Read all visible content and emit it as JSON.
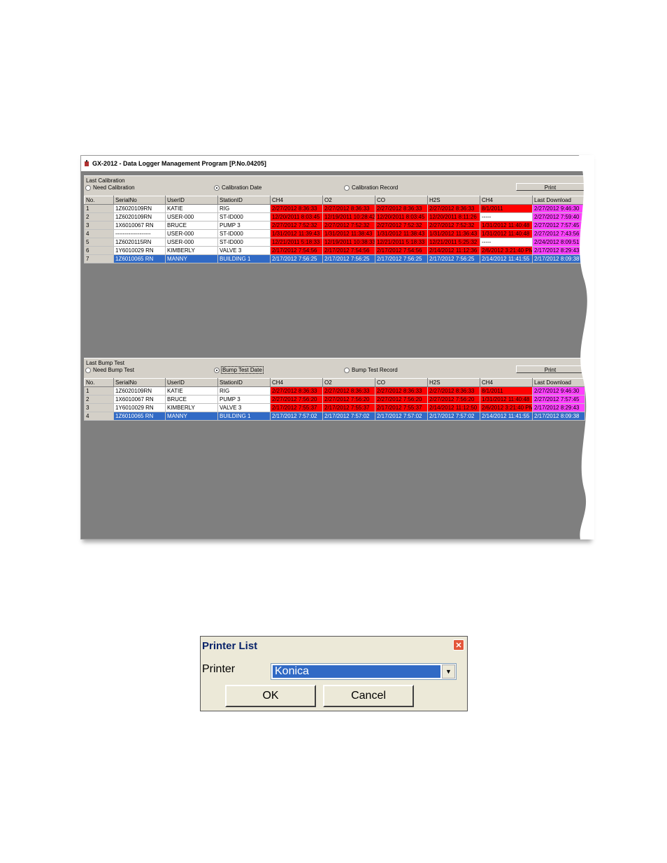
{
  "window": {
    "title": "GX-2012  - Data Logger Management Program [P.No.04205]"
  },
  "calibration": {
    "group_label": "Last Calibration",
    "radio_need": "Need Calibration",
    "radio_date": "Calibration Date",
    "radio_record": "Calibration Record",
    "print_label": "Print",
    "columns": [
      "No.",
      "SerialNo",
      "UserID",
      "StationID",
      "CH4",
      "O2",
      "CO",
      "H2S",
      "CH4",
      "Last Download"
    ],
    "rows": [
      {
        "no": "1",
        "serial": "1Z6020109RN",
        "user": "KATIE",
        "station": "RIG",
        "ch4": "2/27/2012 8:36:33",
        "o2": "2/27/2012 8:36:33",
        "co": "2/27/2012 8:36:33",
        "h2s": "2/27/2012 8:36:33",
        "ch4b": "8/1/2011",
        "dl": "2/27/2012 9:46:30",
        "ch4b_white": false
      },
      {
        "no": "2",
        "serial": "1Z6020109RN",
        "user": "USER-000",
        "station": "ST-ID000",
        "ch4": "12/20/2011 8:03:45",
        "o2": "12/19/2011 10:28:42",
        "co": "12/20/2011 8:03:45",
        "h2s": "12/20/2011 8:11:26",
        "ch4b": "-----",
        "dl": "2/27/2012 7:59:40",
        "ch4b_white": true
      },
      {
        "no": "3",
        "serial": "1X6010067 RN",
        "user": "BRUCE",
        "station": "PUMP 3",
        "ch4": "2/27/2012 7:52:32",
        "o2": "2/27/2012 7:52:32",
        "co": "2/27/2012 7:52:32",
        "h2s": "2/27/2012 7:52:32",
        "ch4b": "1/31/2012 11:40:48",
        "dl": "2/27/2012 7:57:45",
        "ch4b_white": false
      },
      {
        "no": "4",
        "serial": "-------------------",
        "user": "USER-000",
        "station": "ST-ID000",
        "ch4": "1/31/2012 11:39:43",
        "o2": "1/31/2012 11:38:43",
        "co": "1/31/2012 11:38:43",
        "h2s": "1/31/2012 11:36:43",
        "ch4b": "1/31/2012 11:40:48",
        "dl": "2/27/2012 7:43:56",
        "ch4b_white": false
      },
      {
        "no": "5",
        "serial": "1Z6020115RN",
        "user": "USER-000",
        "station": "ST-ID000",
        "ch4": "12/21/2011 5:18:33",
        "o2": "12/19/2011 10:38:33",
        "co": "12/21/2011 5:18:33",
        "h2s": "12/21/2011 5:25:32",
        "ch4b": "-----",
        "dl": "2/24/2012 8:09:51",
        "ch4b_white": true
      },
      {
        "no": "6",
        "serial": "1Y6010029 RN",
        "user": "KIMBERLY",
        "station": "VALVE 3",
        "ch4": "2/17/2012 7:54:56",
        "o2": "2/17/2012 7:54:56",
        "co": "2/17/2012 7:54:56",
        "h2s": "2/14/2012 11:12:36",
        "ch4b": "2/6/2012 3:21:40 PM",
        "dl": "2/17/2012 8:29:43",
        "ch4b_white": false
      },
      {
        "no": "7",
        "serial": "1Z6010065 RN",
        "user": "MANNY",
        "station": "BUILDING 1",
        "ch4": "2/17/2012 7:56:25",
        "o2": "2/17/2012 7:56:25",
        "co": "2/17/2012 7:56:25",
        "h2s": "2/17/2012 7:56:25",
        "ch4b": "2/14/2012 11:41:55",
        "dl": "2/17/2012 8:09:38",
        "ch4b_white": false
      }
    ]
  },
  "bump": {
    "group_label": "Last Bump Test",
    "radio_need": "Need Bump Test",
    "radio_date": "Bump Test Date",
    "radio_record": "Bump Test Record",
    "print_label": "Print",
    "columns": [
      "No.",
      "SerialNo",
      "UserID",
      "StationID",
      "CH4",
      "O2",
      "CO",
      "H2S",
      "CH4",
      "Last Download"
    ],
    "rows": [
      {
        "no": "1",
        "serial": "1Z6020109RN",
        "user": "KATIE",
        "station": "RIG",
        "ch4": "2/27/2012 8:36:33",
        "o2": "2/27/2012 8:36:33",
        "co": "2/27/2012 8:36:33",
        "h2s": "2/27/2012 8:36:33",
        "ch4b": "8/1/2011",
        "dl": "2/27/2012 9:46:30",
        "ch4b_white": false
      },
      {
        "no": "2",
        "serial": "1X6010067 RN",
        "user": "BRUCE",
        "station": "PUMP 3",
        "ch4": "2/27/2012 7:56:20",
        "o2": "2/27/2012 7:56:20",
        "co": "2/27/2012 7:56:20",
        "h2s": "2/27/2012 7:56:20",
        "ch4b": "1/31/2012 11:40:48",
        "dl": "2/27/2012 7:57:45",
        "ch4b_white": false
      },
      {
        "no": "3",
        "serial": "1Y6010029 RN",
        "user": "KIMBERLY",
        "station": "VALVE 3",
        "ch4": "2/17/2012 7:55:37",
        "o2": "2/17/2012 7:55:37",
        "co": "2/17/2012 7:55:37",
        "h2s": "2/14/2012 11:12:50",
        "ch4b": "2/6/2012 3:21:40 PM",
        "dl": "2/17/2012 8:29:43",
        "ch4b_white": false
      },
      {
        "no": "4",
        "serial": "1Z6010065 RN",
        "user": "MANNY",
        "station": "BUILDING 1",
        "ch4": "2/17/2012 7:57:02",
        "o2": "2/17/2012 7:57:02",
        "co": "2/17/2012 7:57:02",
        "h2s": "2/17/2012 7:57:02",
        "ch4b": "2/14/2012 11:41:55",
        "dl": "2/17/2012 8:09:38",
        "ch4b_white": false
      }
    ]
  },
  "dialog": {
    "title": "Printer List",
    "close_icon": "close-icon",
    "printer_label": "Printer",
    "printer_value": "Konica",
    "ok_label": "OK",
    "cancel_label": "Cancel"
  }
}
